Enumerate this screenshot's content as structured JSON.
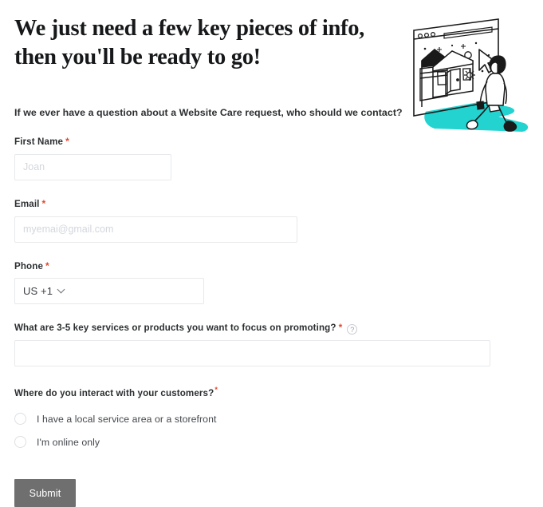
{
  "heading": {
    "line1": "We just need a few key pieces of info,",
    "line2": "then you'll be ready to go!"
  },
  "illustration": {
    "name": "person-walking-into-browser-storefront-illustration",
    "path_color": "#22d3d0",
    "line_color": "#1a1a1a"
  },
  "form": {
    "intro_question": "If we ever have a question about a Website Care request, who should we contact?",
    "first_name": {
      "label": "First Name",
      "required_marker": "*",
      "placeholder": "Joan",
      "value": ""
    },
    "email": {
      "label": "Email",
      "required_marker": "*",
      "placeholder": "myemai@gmail.com",
      "value": ""
    },
    "phone": {
      "label": "Phone",
      "required_marker": "*",
      "country_code": "US +1",
      "chevron": "chevron-down-icon"
    },
    "services": {
      "label": "What are 3-5 key services or products you want to focus on promoting?",
      "required_marker": "*",
      "help_icon": "?",
      "placeholder": "",
      "value": ""
    },
    "interaction": {
      "label": "Where do you interact with your customers?",
      "required_marker": "*",
      "options": [
        {
          "label": "I have a local service area or a storefront",
          "selected": false
        },
        {
          "label": "I'm online only",
          "selected": false
        }
      ]
    },
    "submit_label": "Submit"
  },
  "colors": {
    "required_red": "#e8452c",
    "submit_gray": "#6f6f6f",
    "border_gray": "#e7e9ec",
    "teal": "#22d3d0"
  }
}
